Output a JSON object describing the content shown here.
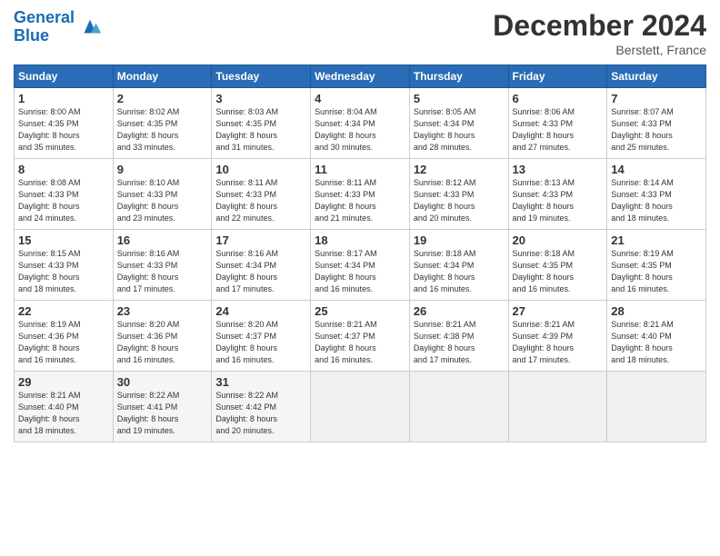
{
  "header": {
    "logo_line1": "General",
    "logo_line2": "Blue",
    "title": "December 2024",
    "location": "Berstett, France"
  },
  "days_of_week": [
    "Sunday",
    "Monday",
    "Tuesday",
    "Wednesday",
    "Thursday",
    "Friday",
    "Saturday"
  ],
  "weeks": [
    [
      {
        "day": "1",
        "info": "Sunrise: 8:00 AM\nSunset: 4:35 PM\nDaylight: 8 hours\nand 35 minutes."
      },
      {
        "day": "2",
        "info": "Sunrise: 8:02 AM\nSunset: 4:35 PM\nDaylight: 8 hours\nand 33 minutes."
      },
      {
        "day": "3",
        "info": "Sunrise: 8:03 AM\nSunset: 4:35 PM\nDaylight: 8 hours\nand 31 minutes."
      },
      {
        "day": "4",
        "info": "Sunrise: 8:04 AM\nSunset: 4:34 PM\nDaylight: 8 hours\nand 30 minutes."
      },
      {
        "day": "5",
        "info": "Sunrise: 8:05 AM\nSunset: 4:34 PM\nDaylight: 8 hours\nand 28 minutes."
      },
      {
        "day": "6",
        "info": "Sunrise: 8:06 AM\nSunset: 4:33 PM\nDaylight: 8 hours\nand 27 minutes."
      },
      {
        "day": "7",
        "info": "Sunrise: 8:07 AM\nSunset: 4:33 PM\nDaylight: 8 hours\nand 25 minutes."
      }
    ],
    [
      {
        "day": "8",
        "info": "Sunrise: 8:08 AM\nSunset: 4:33 PM\nDaylight: 8 hours\nand 24 minutes."
      },
      {
        "day": "9",
        "info": "Sunrise: 8:10 AM\nSunset: 4:33 PM\nDaylight: 8 hours\nand 23 minutes."
      },
      {
        "day": "10",
        "info": "Sunrise: 8:11 AM\nSunset: 4:33 PM\nDaylight: 8 hours\nand 22 minutes."
      },
      {
        "day": "11",
        "info": "Sunrise: 8:11 AM\nSunset: 4:33 PM\nDaylight: 8 hours\nand 21 minutes."
      },
      {
        "day": "12",
        "info": "Sunrise: 8:12 AM\nSunset: 4:33 PM\nDaylight: 8 hours\nand 20 minutes."
      },
      {
        "day": "13",
        "info": "Sunrise: 8:13 AM\nSunset: 4:33 PM\nDaylight: 8 hours\nand 19 minutes."
      },
      {
        "day": "14",
        "info": "Sunrise: 8:14 AM\nSunset: 4:33 PM\nDaylight: 8 hours\nand 18 minutes."
      }
    ],
    [
      {
        "day": "15",
        "info": "Sunrise: 8:15 AM\nSunset: 4:33 PM\nDaylight: 8 hours\nand 18 minutes."
      },
      {
        "day": "16",
        "info": "Sunrise: 8:16 AM\nSunset: 4:33 PM\nDaylight: 8 hours\nand 17 minutes."
      },
      {
        "day": "17",
        "info": "Sunrise: 8:16 AM\nSunset: 4:34 PM\nDaylight: 8 hours\nand 17 minutes."
      },
      {
        "day": "18",
        "info": "Sunrise: 8:17 AM\nSunset: 4:34 PM\nDaylight: 8 hours\nand 16 minutes."
      },
      {
        "day": "19",
        "info": "Sunrise: 8:18 AM\nSunset: 4:34 PM\nDaylight: 8 hours\nand 16 minutes."
      },
      {
        "day": "20",
        "info": "Sunrise: 8:18 AM\nSunset: 4:35 PM\nDaylight: 8 hours\nand 16 minutes."
      },
      {
        "day": "21",
        "info": "Sunrise: 8:19 AM\nSunset: 4:35 PM\nDaylight: 8 hours\nand 16 minutes."
      }
    ],
    [
      {
        "day": "22",
        "info": "Sunrise: 8:19 AM\nSunset: 4:36 PM\nDaylight: 8 hours\nand 16 minutes."
      },
      {
        "day": "23",
        "info": "Sunrise: 8:20 AM\nSunset: 4:36 PM\nDaylight: 8 hours\nand 16 minutes."
      },
      {
        "day": "24",
        "info": "Sunrise: 8:20 AM\nSunset: 4:37 PM\nDaylight: 8 hours\nand 16 minutes."
      },
      {
        "day": "25",
        "info": "Sunrise: 8:21 AM\nSunset: 4:37 PM\nDaylight: 8 hours\nand 16 minutes."
      },
      {
        "day": "26",
        "info": "Sunrise: 8:21 AM\nSunset: 4:38 PM\nDaylight: 8 hours\nand 17 minutes."
      },
      {
        "day": "27",
        "info": "Sunrise: 8:21 AM\nSunset: 4:39 PM\nDaylight: 8 hours\nand 17 minutes."
      },
      {
        "day": "28",
        "info": "Sunrise: 8:21 AM\nSunset: 4:40 PM\nDaylight: 8 hours\nand 18 minutes."
      }
    ],
    [
      {
        "day": "29",
        "info": "Sunrise: 8:21 AM\nSunset: 4:40 PM\nDaylight: 8 hours\nand 18 minutes."
      },
      {
        "day": "30",
        "info": "Sunrise: 8:22 AM\nSunset: 4:41 PM\nDaylight: 8 hours\nand 19 minutes."
      },
      {
        "day": "31",
        "info": "Sunrise: 8:22 AM\nSunset: 4:42 PM\nDaylight: 8 hours\nand 20 minutes."
      },
      null,
      null,
      null,
      null
    ]
  ]
}
